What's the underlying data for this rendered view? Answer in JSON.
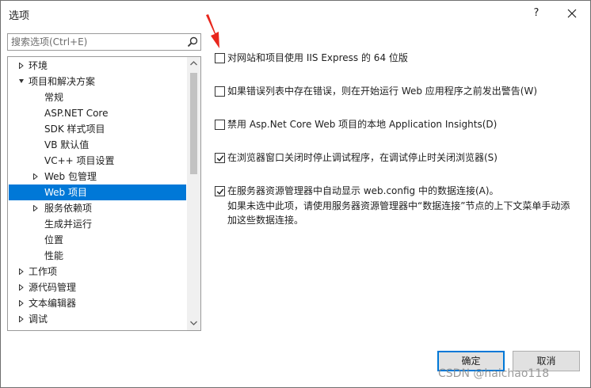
{
  "window": {
    "title": "选项",
    "help_label": "?"
  },
  "search": {
    "placeholder": "搜索选项(Ctrl+E)"
  },
  "tree": {
    "items": [
      {
        "label": "环境",
        "expander": "collapsed"
      },
      {
        "label": "项目和解决方案",
        "expander": "expanded"
      },
      {
        "label": "常规",
        "expander": "none"
      },
      {
        "label": "ASP.NET Core",
        "expander": "none"
      },
      {
        "label": "SDK 样式项目",
        "expander": "none"
      },
      {
        "label": "VB 默认值",
        "expander": "none"
      },
      {
        "label": "VC++ 项目设置",
        "expander": "none"
      },
      {
        "label": "Web 包管理",
        "expander": "collapsed"
      },
      {
        "label": "Web 项目",
        "expander": "none",
        "selected": true
      },
      {
        "label": "服务依赖项",
        "expander": "collapsed"
      },
      {
        "label": "生成并运行",
        "expander": "none"
      },
      {
        "label": "位置",
        "expander": "none"
      },
      {
        "label": "性能",
        "expander": "none"
      },
      {
        "label": "工作项",
        "expander": "collapsed"
      },
      {
        "label": "源代码管理",
        "expander": "collapsed"
      },
      {
        "label": "文本编辑器",
        "expander": "collapsed"
      },
      {
        "label": "调试",
        "expander": "collapsed"
      }
    ]
  },
  "options": [
    {
      "label": "对网站和项目使用 IIS Express 的 64 位版",
      "checked": false
    },
    {
      "label": "如果错误列表中存在错误，则在开始运行 Web 应用程序之前发出警告(W)",
      "checked": false
    },
    {
      "label": "禁用 Asp.Net Core Web 项目的本地 Application Insights(D)",
      "checked": false
    },
    {
      "label": "在浏览器窗口关闭时停止调试程序，在调试停止时关闭浏览器(S)",
      "checked": true
    },
    {
      "label": "在服务器资源管理器中自动显示 web.config 中的数据连接(A)。",
      "checked": true,
      "description": "如果未选中此项，请使用服务器资源管理器中“数据连接”节点的上下文菜单手动添加这些数据连接。"
    }
  ],
  "buttons": {
    "ok": "确定",
    "cancel": "取消"
  },
  "watermark": "CSDN @haichao118",
  "colors": {
    "selection": "#0078d7",
    "annotation_arrow": "#e8261c"
  },
  "icons": {
    "search": "magnifier-icon",
    "close": "close-icon",
    "expand": "triangle-right-icon",
    "collapse": "triangle-down-icon",
    "checkmark": "checkmark-icon"
  }
}
